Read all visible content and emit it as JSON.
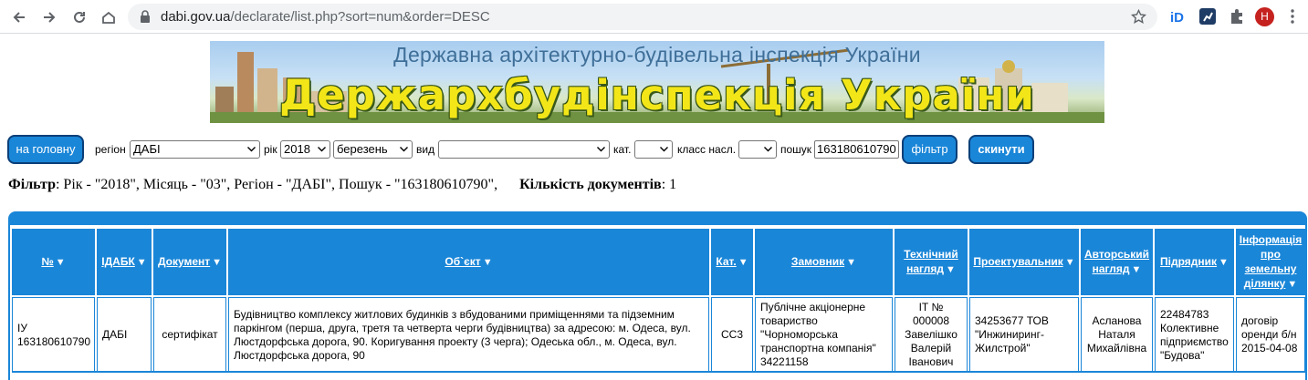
{
  "browser": {
    "url_host": "dabi.gov.ua",
    "url_path": "/declarate/list.php?sort=num&order=DESC",
    "avatar_letter": "Н"
  },
  "banner": {
    "subtitle": "Державна архітектурно-будівельна інспекція України",
    "title": "Держархбудінспекція України"
  },
  "filters": {
    "home_button": "на головну",
    "region_label": "регіон",
    "region_value": "ДАБІ",
    "year_label": "рік",
    "year_value": "2018",
    "month_value": "березень",
    "type_label": "вид",
    "type_value": "",
    "cat_label": "кат.",
    "cat_value": "",
    "class_label": "класс насл.",
    "class_value": "",
    "search_label": "пошук",
    "search_value": "163180610790",
    "filter_button": "фільтр",
    "reset_button": "скинути"
  },
  "summary": {
    "filter_label": "Фільтр",
    "filter_text": ": Рік - \"2018\", Місяць - \"03\", Регіон - \"ДАБІ\", Пошук - \"163180610790\",",
    "count_label": "Кількість документів",
    "count_text": ": 1"
  },
  "table": {
    "headers": [
      "№",
      "ІДАБК",
      "Документ",
      "Об`єкт",
      "Кат.",
      "Замовник",
      "Технічний нагляд",
      "Проектувальник",
      "Авторський нагляд",
      "Підрядник",
      "Інформація про земельну ділянку"
    ],
    "sort_icon": "▼",
    "row": {
      "num": "ІУ 163180610790",
      "idabk": "ДАБІ",
      "document": "сертифікат",
      "object": "Будівництво комплексу житлових будинків з вбудованими приміщеннями та підземним паркінгом (перша, друга, третя та четверта черги будівництва) за адресою: м. Одеса, вул. Люстдорфська дорога, 90. Коригування проекту (3 черга); Одеська обл., м. Одеса, вул. Люстдорфська дорога, 90",
      "cat": "СС3",
      "customer": "Публічне акціонерне товариство \"Чорноморська транспортна компанія\" 34221158",
      "tech_supervision": "ІТ № 000008 Завелішко Валерій Іванович",
      "designer": "34253677 ТОВ \"Инжиниринг-Жилстрой\"",
      "author_supervision": "Асланова Наталя Михайлівна",
      "contractor": "22484783 Колективне підприємство \"Будова\"",
      "land_info": "договір оренди б/н 2015-04-08"
    }
  },
  "colors": {
    "accent": "#1a86d8",
    "button_border": "#0b3f78",
    "banner_title": "#f3e618"
  }
}
